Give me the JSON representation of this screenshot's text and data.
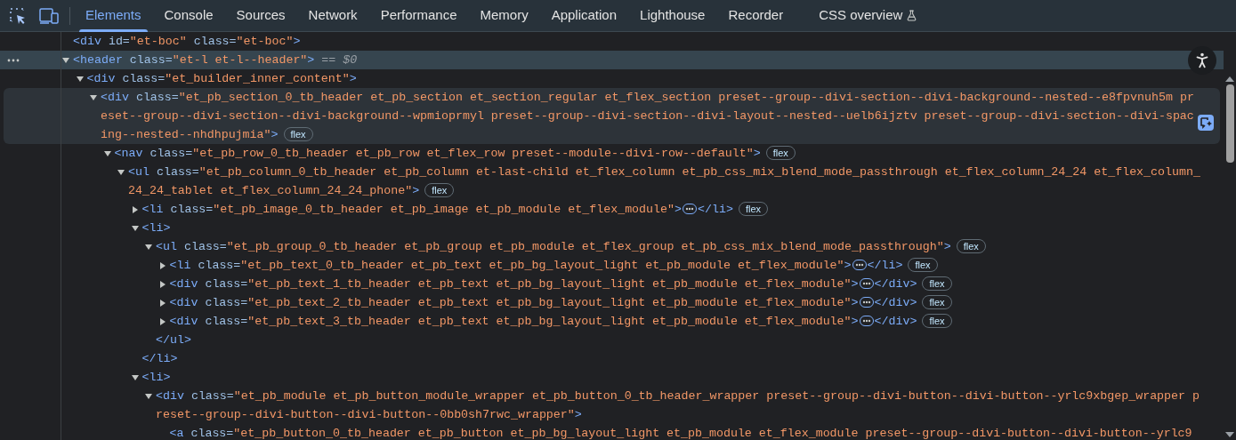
{
  "tabs": [
    {
      "label": "Elements",
      "selected": true,
      "experimental": false
    },
    {
      "label": "Console",
      "selected": false,
      "experimental": false
    },
    {
      "label": "Sources",
      "selected": false,
      "experimental": false
    },
    {
      "label": "Network",
      "selected": false,
      "experimental": false
    },
    {
      "label": "Performance",
      "selected": false,
      "experimental": false
    },
    {
      "label": "Memory",
      "selected": false,
      "experimental": false
    },
    {
      "label": "Application",
      "selected": false,
      "experimental": false
    },
    {
      "label": "Lighthouse",
      "selected": false,
      "experimental": false
    },
    {
      "label": "Recorder",
      "selected": false,
      "experimental": false
    },
    {
      "label": "CSS overview",
      "selected": false,
      "experimental": true
    }
  ],
  "dom_tree": [
    {
      "open": "<div id=\"et-boc\" class=\"et-boc\">",
      "selected": false,
      "hovered": false
    },
    {
      "open": "<header class=\"et-l et-l--header\">",
      "suffix": "== $0",
      "selected": true,
      "hovered": false,
      "expanded": true,
      "children": [
        {
          "open": "<div class=\"et_builder_inner_content\">",
          "selected": false,
          "hovered": false,
          "expanded": true,
          "children": [
            {
              "open": "<div class=\"et_pb_section_0_tb_header et_pb_section et_section_regular et_flex_section preset--group--divi-section--divi-background--nested--e8fpvnuh5m preset--group--divi-section--divi-background--wpmioprmyl preset--group--divi-section--divi-layout--nested--uelb6ijztv preset--group--divi-section--divi-spacing--nested--nhdhpujmia\">",
              "badge": "flex",
              "selected": false,
              "hovered": true,
              "expanded": true,
              "children": [
                {
                  "open": "<nav class=\"et_pb_row_0_tb_header et_pb_row et_flex_row preset--module--divi-row--default\">",
                  "badge": "flex",
                  "selected": false,
                  "hovered": false,
                  "expanded": true,
                  "children": [
                    {
                      "open": "<ul class=\"et_pb_column_0_tb_header et_pb_column et-last-child et_flex_column et_pb_css_mix_blend_mode_passthrough et_flex_column_24_24 et_flex_column_24_24_tablet et_flex_column_24_24_phone\">",
                      "badge": "flex",
                      "selected": false,
                      "hovered": false,
                      "expanded": true,
                      "children": [
                        {
                          "open": "<li class=\"et_pb_image_0_tb_header et_pb_image et_pb_module et_flex_module\">",
                          "close": "</li>",
                          "badge": "flex",
                          "selected": false,
                          "hovered": false,
                          "expanded": false
                        },
                        {
                          "open": "<li>",
                          "close": "</li>",
                          "selected": false,
                          "hovered": false,
                          "expanded": true,
                          "children": [
                            {
                              "open": "<ul class=\"et_pb_group_0_tb_header et_pb_group et_pb_module et_flex_group et_pb_css_mix_blend_mode_passthrough\">",
                              "close": "</ul>",
                              "badge": "flex",
                              "selected": false,
                              "hovered": false,
                              "expanded": true,
                              "children": [
                                {
                                  "open": "<li class=\"et_pb_text_0_tb_header et_pb_text et_pb_bg_layout_light et_pb_module et_flex_module\">",
                                  "close": "</li>",
                                  "badge": "flex",
                                  "selected": false,
                                  "hovered": false,
                                  "expanded": false
                                },
                                {
                                  "open": "<div class=\"et_pb_text_1_tb_header et_pb_text et_pb_bg_layout_light et_pb_module et_flex_module\">",
                                  "close": "</div>",
                                  "badge": "flex",
                                  "selected": false,
                                  "hovered": false,
                                  "expanded": false
                                },
                                {
                                  "open": "<div class=\"et_pb_text_2_tb_header et_pb_text et_pb_bg_layout_light et_pb_module et_flex_module\">",
                                  "close": "</div>",
                                  "badge": "flex",
                                  "selected": false,
                                  "hovered": false,
                                  "expanded": false
                                },
                                {
                                  "open": "<div class=\"et_pb_text_3_tb_header et_pb_text et_pb_bg_layout_light et_pb_module et_flex_module\">",
                                  "close": "</div>",
                                  "badge": "flex",
                                  "selected": false,
                                  "hovered": false,
                                  "expanded": false
                                }
                              ]
                            }
                          ]
                        },
                        {
                          "open": "<li>",
                          "selected": false,
                          "hovered": false,
                          "expanded": true,
                          "children": [
                            {
                              "open": "<div class=\"et_pb_module et_pb_button_module_wrapper et_pb_button_0_tb_header_wrapper preset--group--divi-button--divi-button--yrlc9xbgep_wrapper preset--group--divi-button--divi-button--0bb0sh7rwc_wrapper\">",
                              "selected": false,
                              "hovered": false,
                              "expanded": true,
                              "children": [
                                {
                                  "open": "<a class=\"et_pb_button_0_tb_header et_pb_button et_pb_bg_layout_light et_pb_module et_flex_module preset--group--divi-button--divi-button--yrlc9",
                                  "selected": false,
                                  "hovered": false
                                }
                              ]
                            }
                          ]
                        }
                      ]
                    }
                  ]
                }
              ]
            }
          ]
        }
      ]
    }
  ]
}
